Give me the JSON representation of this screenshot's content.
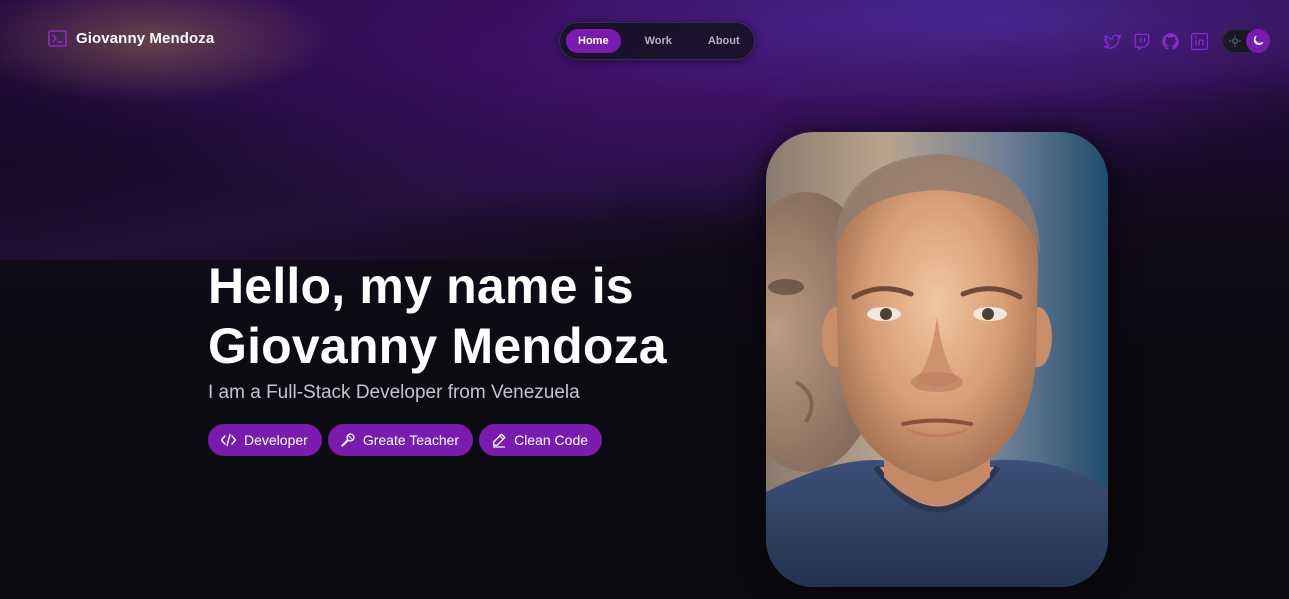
{
  "brand": {
    "name": "Giovanny Mendoza",
    "icon": "terminal-icon"
  },
  "nav": {
    "items": [
      {
        "label": "Home",
        "active": true
      },
      {
        "label": "Work",
        "active": false
      },
      {
        "label": "About",
        "active": false
      }
    ]
  },
  "socials": [
    {
      "icon": "twitter-icon"
    },
    {
      "icon": "twitch-icon"
    },
    {
      "icon": "github-icon"
    },
    {
      "icon": "linkedin-icon"
    }
  ],
  "theme_toggle": {
    "icons": [
      "sun-icon",
      "moon-icon"
    ],
    "mode": "dark"
  },
  "hero": {
    "title_line1": "Hello, my name is",
    "title_line2": "Giovanny Mendoza",
    "subtitle": "I am a Full-Stack Developer from Venezuela",
    "tags": [
      {
        "label": "Developer",
        "icon": "code-icon"
      },
      {
        "label": "Greate Teacher",
        "icon": "microphone-icon"
      },
      {
        "label": "Clean Code",
        "icon": "pencil-icon"
      }
    ]
  },
  "colors": {
    "accent": "#7a1bb0",
    "background": "#0d0c12",
    "text": "#ffffff",
    "muted": "#c7c3cf"
  }
}
